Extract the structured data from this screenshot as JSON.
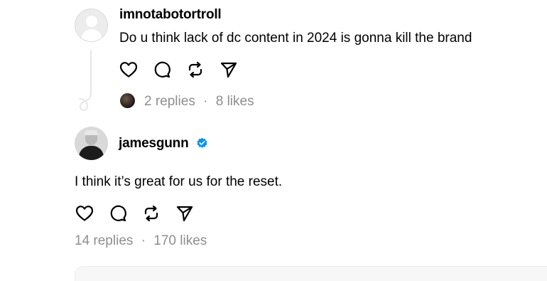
{
  "posts": [
    {
      "username": "imnotabotortroll",
      "text": "Do u think lack of dc content in 2024 is gonna kill the brand",
      "replies": "2 replies",
      "separator": "·",
      "likes": "8 likes",
      "avatar": "default-avatar-icon",
      "actions": [
        "heart-icon",
        "comment-icon",
        "repost-icon",
        "share-icon"
      ]
    },
    {
      "username": "jamesgunn",
      "verified": true,
      "text": "I think it’s great for us for the reset.",
      "replies": "14 replies",
      "separator": "·",
      "likes": "170 likes",
      "avatar": "profile-photo",
      "actions": [
        "heart-icon",
        "comment-icon",
        "repost-icon",
        "share-icon"
      ]
    }
  ],
  "colors": {
    "text": "#000000",
    "meta": "#8e8e8e",
    "verified": "#0095f6",
    "thread_line": "#e6e6e6"
  }
}
